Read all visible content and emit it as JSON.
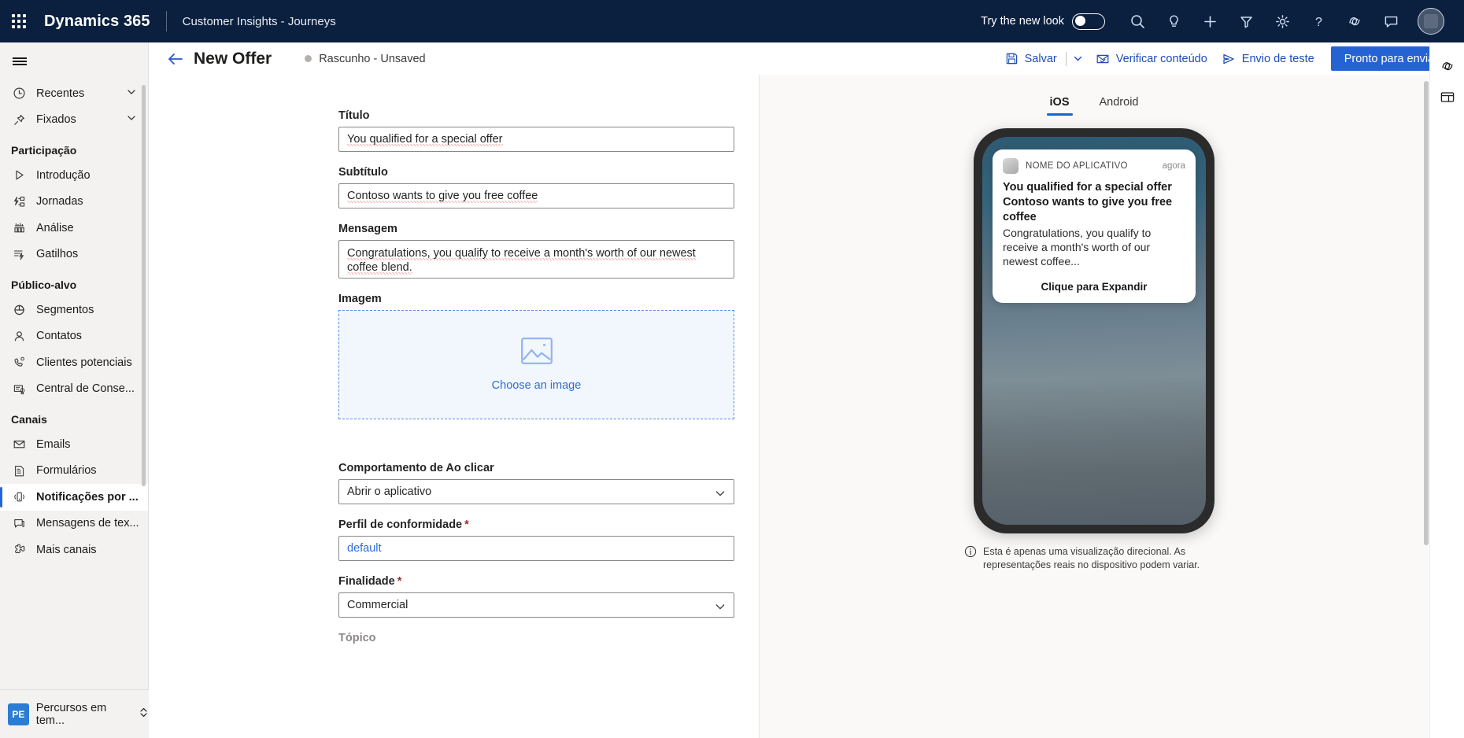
{
  "topbar": {
    "waffle_label": "app-launcher",
    "brand": "Dynamics 365",
    "app_name": "Customer Insights - Journeys",
    "new_look_label": "Try the new look",
    "toggle_state": "off",
    "icons": [
      {
        "name": "search-icon",
        "label": "Pesquisar"
      },
      {
        "name": "lightbulb-icon",
        "label": "Ideias"
      },
      {
        "name": "plus-icon",
        "label": "Novo"
      },
      {
        "name": "filter-icon",
        "label": "Filtro"
      },
      {
        "name": "gear-icon",
        "label": "Configurações"
      },
      {
        "name": "help-icon",
        "label": "Ajuda"
      },
      {
        "name": "copilot-icon",
        "label": "Copilot"
      },
      {
        "name": "feedback-icon",
        "label": "Comentários"
      }
    ],
    "avatar_label": "Conta de usuário"
  },
  "sidebar": {
    "menu_toggle_label": "Menu",
    "collapsibles": [
      {
        "label": "Recentes",
        "icon": "clock-icon"
      },
      {
        "label": "Fixados",
        "icon": "pin-icon"
      }
    ],
    "groups": [
      {
        "title": "Participação",
        "items": [
          {
            "label": "Introdução",
            "icon": "play-icon",
            "selected": false
          },
          {
            "label": "Jornadas",
            "icon": "journey-icon",
            "selected": false
          },
          {
            "label": "Análise",
            "icon": "analytics-icon",
            "selected": false
          },
          {
            "label": "Gatilhos",
            "icon": "trigger-icon",
            "selected": false
          }
        ]
      },
      {
        "title": "Público-alvo",
        "items": [
          {
            "label": "Segmentos",
            "icon": "piechart-icon",
            "selected": false
          },
          {
            "label": "Contatos",
            "icon": "person-icon",
            "selected": false
          },
          {
            "label": "Clientes potenciais",
            "icon": "lead-icon",
            "selected": false
          },
          {
            "label": "Central de Conse...",
            "icon": "consent-icon",
            "selected": false
          }
        ]
      },
      {
        "title": "Canais",
        "items": [
          {
            "label": "Emails",
            "icon": "mail-icon",
            "selected": false
          },
          {
            "label": "Formulários",
            "icon": "form-icon",
            "selected": false
          },
          {
            "label": "Notificações por ...",
            "icon": "push-notification-icon",
            "selected": true
          },
          {
            "label": "Mensagens de tex...",
            "icon": "sms-icon",
            "selected": false
          },
          {
            "label": "Mais canais",
            "icon": "more-channels-icon",
            "selected": false
          }
        ]
      }
    ],
    "footer": {
      "badge": "PE",
      "label": "Percursos em tem..."
    }
  },
  "command_bar": {
    "back_label": "Voltar",
    "title": "New Offer",
    "status": "Rascunho - Unsaved",
    "actions": [
      {
        "label": "Salvar",
        "icon": "save-icon"
      },
      {
        "label": "Verificar conteúdo",
        "icon": "mail-check-icon"
      },
      {
        "label": "Envio de teste",
        "icon": "send-icon"
      }
    ],
    "primary_label": "Pronto para enviar"
  },
  "rail": {
    "icons": [
      {
        "name": "copilot-panel-icon",
        "label": "Copilot"
      },
      {
        "name": "notes-panel-icon",
        "label": "Anotações"
      }
    ]
  },
  "form": {
    "fields": {
      "title": {
        "label": "Título",
        "value": "You qualified for a special offer"
      },
      "subtitle": {
        "label": "Subtítulo",
        "value": "Contoso wants to give you free coffee"
      },
      "message": {
        "label": "Mensagem",
        "value": "Congratulations, you qualify to receive a month's worth of our newest coffee blend."
      },
      "image": {
        "label": "Imagem",
        "cta": "Choose an image",
        "icon": "image-placeholder-icon"
      },
      "click_behavior": {
        "label": "Comportamento de Ao clicar",
        "value": "Abrir o aplicativo"
      },
      "compliance_profile": {
        "label": "Perfil de conformidade",
        "required": true,
        "value": "default"
      },
      "purpose": {
        "label": "Finalidade",
        "required": true,
        "value": "Commercial"
      },
      "topic": {
        "label": "Tópico"
      }
    }
  },
  "preview": {
    "tabs": [
      {
        "label": "iOS",
        "active": true
      },
      {
        "label": "Android",
        "active": false
      }
    ],
    "notification": {
      "app_name": "NOME DO APLICATIVO",
      "time": "agora",
      "title": "You qualified for a special offer",
      "subtitle": "Contoso wants to give you free coffee",
      "body": "Congratulations, you qualify to receive a month's worth of our newest coffee...",
      "expand_label": "Clique para Expandir"
    },
    "disclaimer": "Esta é apenas uma visualização direcional. As representações reais no dispositivo podem variar."
  },
  "colors": {
    "nav_background": "#0b1f3f",
    "accent_blue": "#2563d4",
    "link_blue": "#2b6ed9",
    "required_red": "#a4262c",
    "sidebar_background": "#f3f2f1",
    "canvas_background": "#faf9f8"
  }
}
